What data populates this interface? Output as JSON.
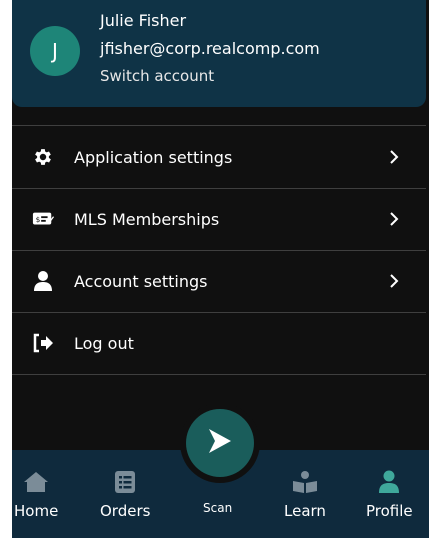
{
  "account": {
    "avatar_initial": "J",
    "name": "Julie Fisher",
    "email": "jfisher@corp.realcomp.com",
    "switch_label": "Switch account"
  },
  "menu": {
    "items": [
      {
        "label": "Application settings",
        "icon": "gear-icon"
      },
      {
        "label": "MLS Memberships",
        "icon": "money-check-icon"
      },
      {
        "label": "Account settings",
        "icon": "user-icon"
      },
      {
        "label": "Log out",
        "icon": "logout-icon"
      }
    ]
  },
  "nav": {
    "home": "Home",
    "orders": "Orders",
    "scan": "Scan",
    "learn": "Learn",
    "profile": "Profile"
  },
  "colors": {
    "background": "#101010",
    "card": "#0f3346",
    "accent": "#1e8578",
    "nav_bar": "#0f2a3d"
  }
}
